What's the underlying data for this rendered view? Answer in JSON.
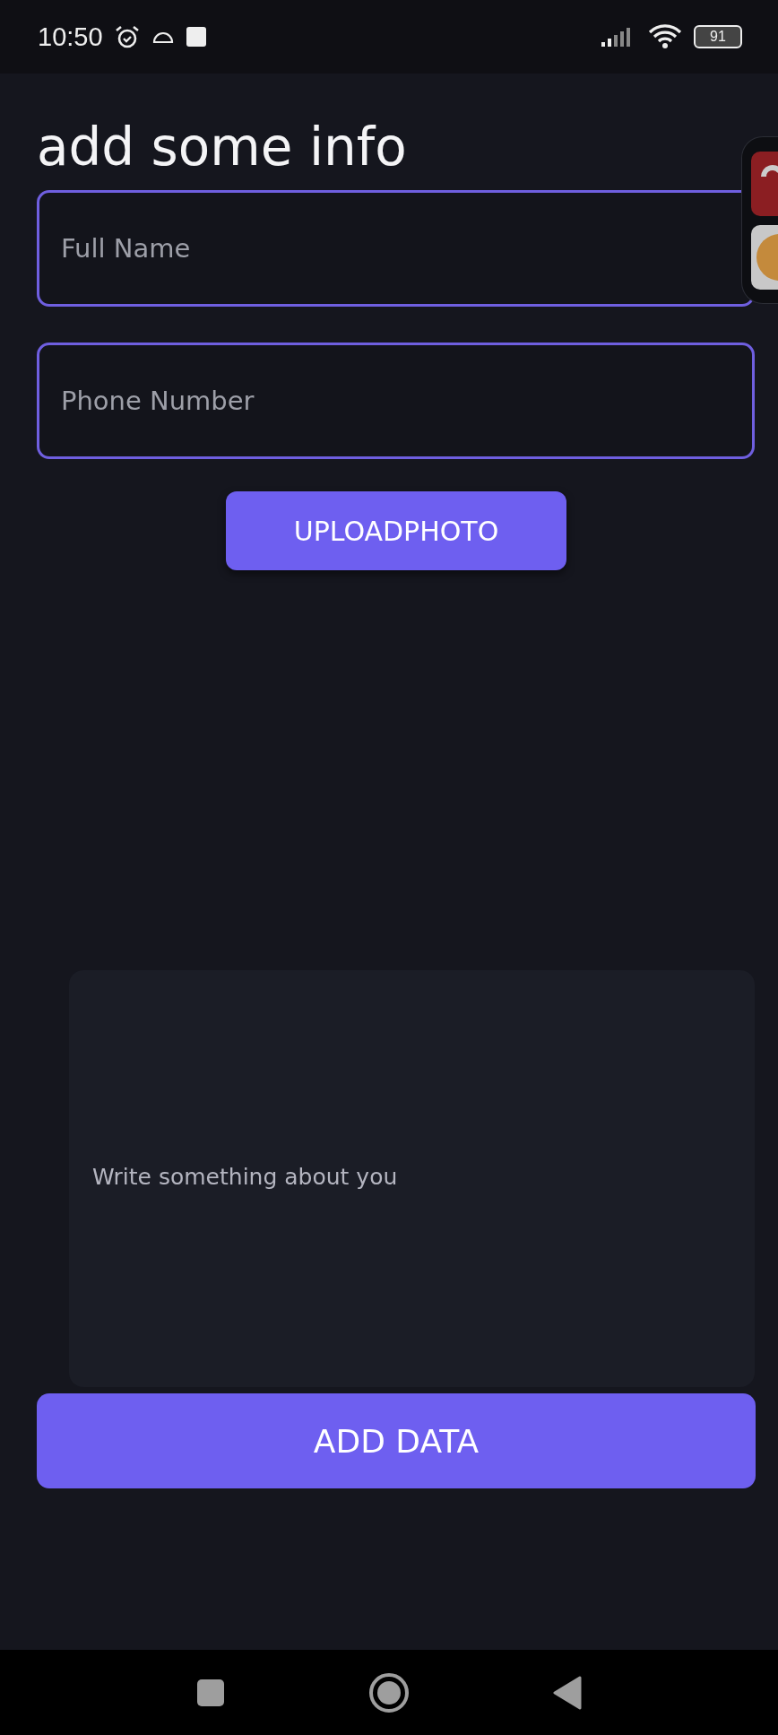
{
  "status_bar": {
    "time": "10:50",
    "battery": "91"
  },
  "title": "add some info",
  "fields": [
    {
      "placeholder": "Full Name"
    },
    {
      "placeholder": "Phone Number"
    }
  ],
  "upload_button": "UPLOADPHOTO",
  "about": {
    "placeholder": "Write something about you"
  },
  "submit_button": "ADD DATA"
}
